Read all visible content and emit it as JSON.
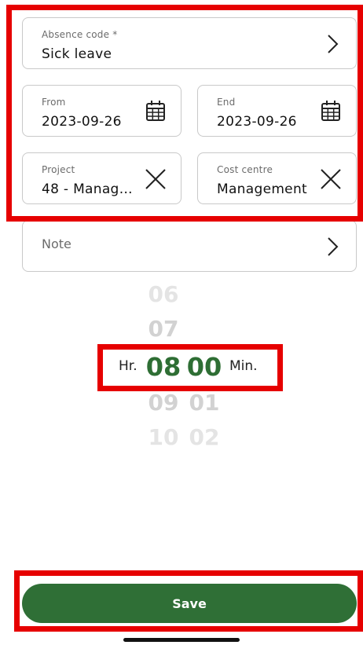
{
  "form": {
    "absence_code": {
      "label": "Absence code *",
      "value": "Sick leave"
    },
    "from": {
      "label": "From",
      "value": "2023-09-26"
    },
    "end": {
      "label": "End",
      "value": "2023-09-26"
    },
    "project": {
      "label": "Project",
      "value": "48 - Manag…"
    },
    "cost_centre": {
      "label": "Cost centre",
      "value": "Management"
    },
    "note": {
      "label": "Note"
    }
  },
  "time_picker": {
    "hours_above": [
      "06",
      "07"
    ],
    "hour_selected": "08",
    "hours_below": [
      "09",
      "10"
    ],
    "minute_selected": "00",
    "minutes_below": [
      "01",
      "02"
    ],
    "hour_unit": "Hr.",
    "minute_unit": "Min."
  },
  "actions": {
    "save_label": "Save"
  },
  "colors": {
    "accent": "#2f6f36",
    "highlight": "#e60000"
  },
  "icons": [
    "chevron-right-icon",
    "calendar-icon",
    "close-icon"
  ]
}
